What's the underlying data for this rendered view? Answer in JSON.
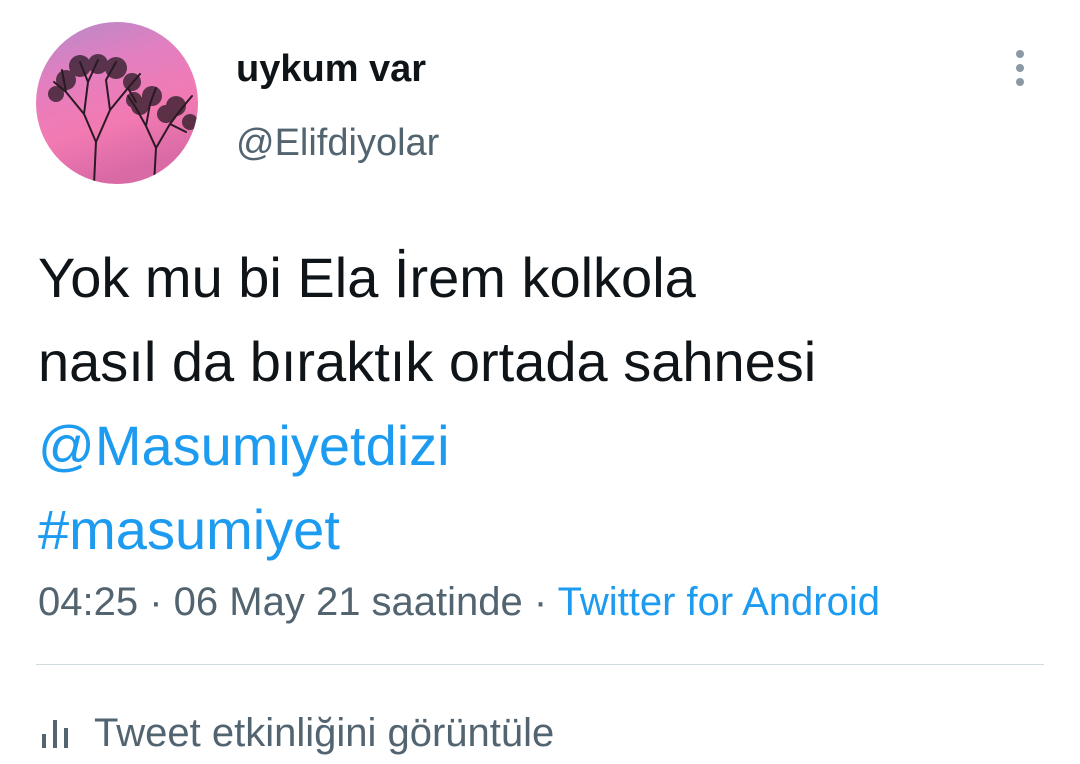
{
  "user": {
    "display_name": "uykum var",
    "handle": "@Elifdiyolar"
  },
  "tweet": {
    "text_line_1": "Yok mu bi Ela İrem kolkola",
    "text_line_2": "nasıl da bıraktık ortada sahnesi",
    "mention": "@Masumiyetdizi",
    "hashtag": "#masumiyet"
  },
  "meta": {
    "time": "04:25",
    "separator": " · ",
    "date": "06 May 21 saatinde",
    "source": "Twitter for Android"
  },
  "activity": {
    "label": "Tweet etkinliğini görüntüle"
  },
  "icons": {
    "more": "more-vertical-icon",
    "activity": "bar-chart-icon"
  },
  "colors": {
    "text": "#0f1419",
    "secondary": "#536471",
    "link": "#1d9bf0",
    "divider": "#cfd9de"
  }
}
